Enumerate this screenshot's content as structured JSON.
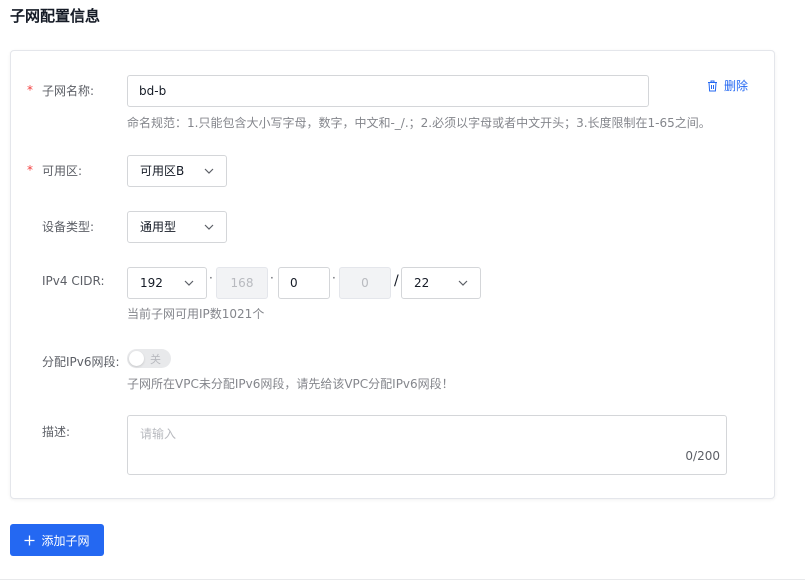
{
  "page_title": "子网配置信息",
  "subnet": {
    "delete_label": "删除",
    "name": {
      "required_mark": "*",
      "label": "子网名称:",
      "value": "bd-b",
      "hint": "命名规范：1.只能包含大小写字母，数字，中文和-_/.；2.必须以字母或者中文开头；3.长度限制在1-65之间。"
    },
    "zone": {
      "required_mark": "*",
      "label": "可用区:",
      "selected": "可用区B"
    },
    "device_type": {
      "label": "设备类型:",
      "selected": "通用型"
    },
    "cidr": {
      "label": "IPv4 CIDR:",
      "octet1": "192",
      "octet2": "168",
      "octet3": "0",
      "octet4": "0",
      "separator_dot": "·",
      "separator_slash": "/",
      "mask": "22",
      "hint": "当前子网可用IP数1021个"
    },
    "ipv6": {
      "label": "分配IPv6网段:",
      "switch_text": "关",
      "hint": "子网所在VPC未分配IPv6网段，请先给该VPC分配IPv6网段！"
    },
    "description": {
      "label": "描述:",
      "placeholder": "请输入",
      "counter": "0/200"
    }
  },
  "add_button_label": "添加子网",
  "colors": {
    "primary": "#2468f2",
    "required": "#f33e3e",
    "border": "#d4d6d9"
  }
}
